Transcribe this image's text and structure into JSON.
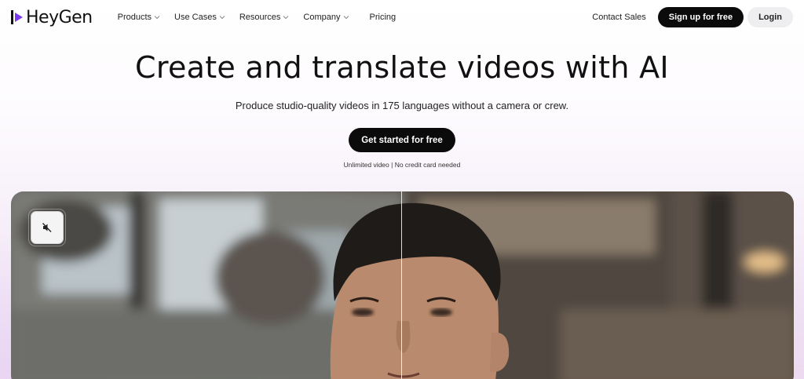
{
  "brand": {
    "name": "HeyGen",
    "accent": "#7c3aed"
  },
  "nav": {
    "items": [
      {
        "label": "Products",
        "has_dropdown": true
      },
      {
        "label": "Use Cases",
        "has_dropdown": true
      },
      {
        "label": "Resources",
        "has_dropdown": true
      },
      {
        "label": "Company",
        "has_dropdown": true
      },
      {
        "label": "Pricing",
        "has_dropdown": false
      }
    ],
    "contact_label": "Contact Sales",
    "signup_label": "Sign up for free",
    "login_label": "Login"
  },
  "hero": {
    "title": "Create and translate videos with AI",
    "subtitle": "Produce studio-quality videos in 175 languages without a camera or crew.",
    "cta_label": "Get started for free",
    "cta_note": "Unlimited video | No credit card needed"
  },
  "video": {
    "mute_icon": "speaker-muted-icon"
  }
}
